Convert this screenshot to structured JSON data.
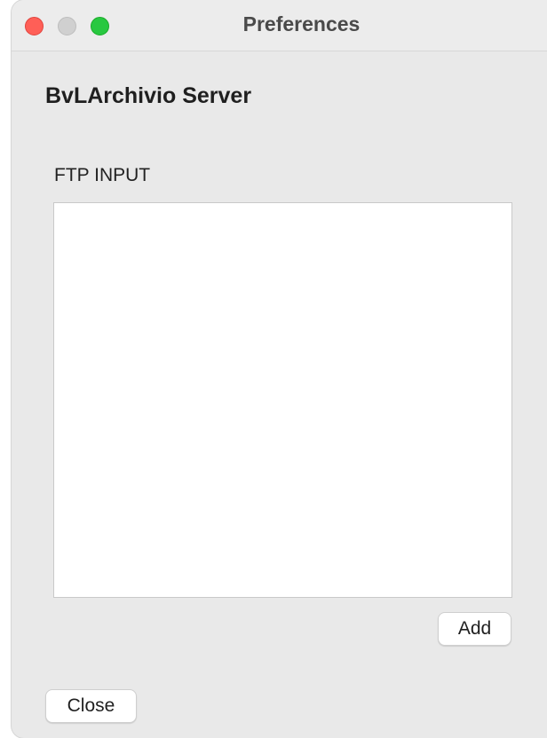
{
  "window": {
    "title": "Preferences"
  },
  "section": {
    "title": "BvLArchivio Server"
  },
  "ftp_input": {
    "label": "FTP INPUT",
    "items": []
  },
  "buttons": {
    "add_label": "Add",
    "close_label": "Close"
  },
  "colors": {
    "traffic_close": "#ff5f57",
    "traffic_minimize_disabled": "#d0d0d0",
    "traffic_zoom": "#28c840",
    "window_background": "#e9e9e9"
  }
}
